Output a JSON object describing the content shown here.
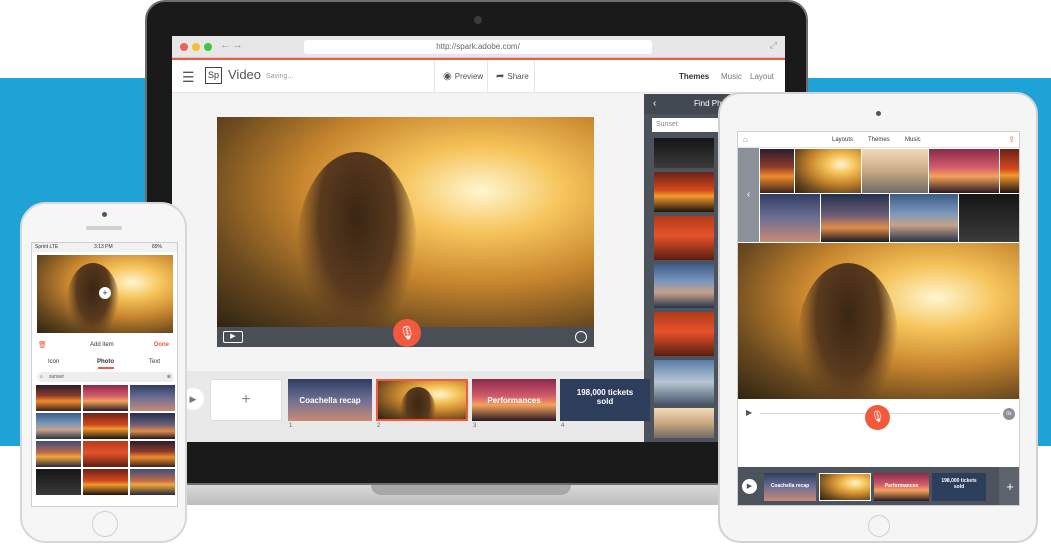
{
  "colors": {
    "accent": "#f15a3d",
    "band": "#1fa3d7",
    "panel": "#4c535c"
  },
  "laptop": {
    "url": "http://spark.adobe.com/",
    "logo": "Sp",
    "app_title": "Video",
    "status": "Saving...",
    "preview_label": "Preview",
    "share_label": "Share",
    "tabs": [
      "Themes",
      "Music",
      "Layout"
    ],
    "panel_title": "Find Photos",
    "panel_search": "Sunset",
    "slides": [
      {
        "text": "Coachella recap",
        "number": "1"
      },
      {
        "text": "",
        "number": "2"
      },
      {
        "text": "Performances",
        "number": "3"
      },
      {
        "text": "198,000 tickets sold",
        "number": "4"
      }
    ],
    "add_label": "+"
  },
  "phone": {
    "carrier": "Sprint  LTE",
    "time": "3:13 PM",
    "battery": "89%",
    "add_item": "Add item",
    "done": "Done",
    "tabs": [
      "Icon",
      "Photo",
      "Text"
    ],
    "search_value": "sunset"
  },
  "tablet": {
    "tabs": [
      "Layouts",
      "Themes",
      "Music"
    ],
    "counter": "0s",
    "slides": [
      {
        "text": "Coachella recap"
      },
      {
        "text": ""
      },
      {
        "text": "Performances"
      },
      {
        "text": "198,000 tickets sold"
      }
    ],
    "add_label": "+"
  }
}
